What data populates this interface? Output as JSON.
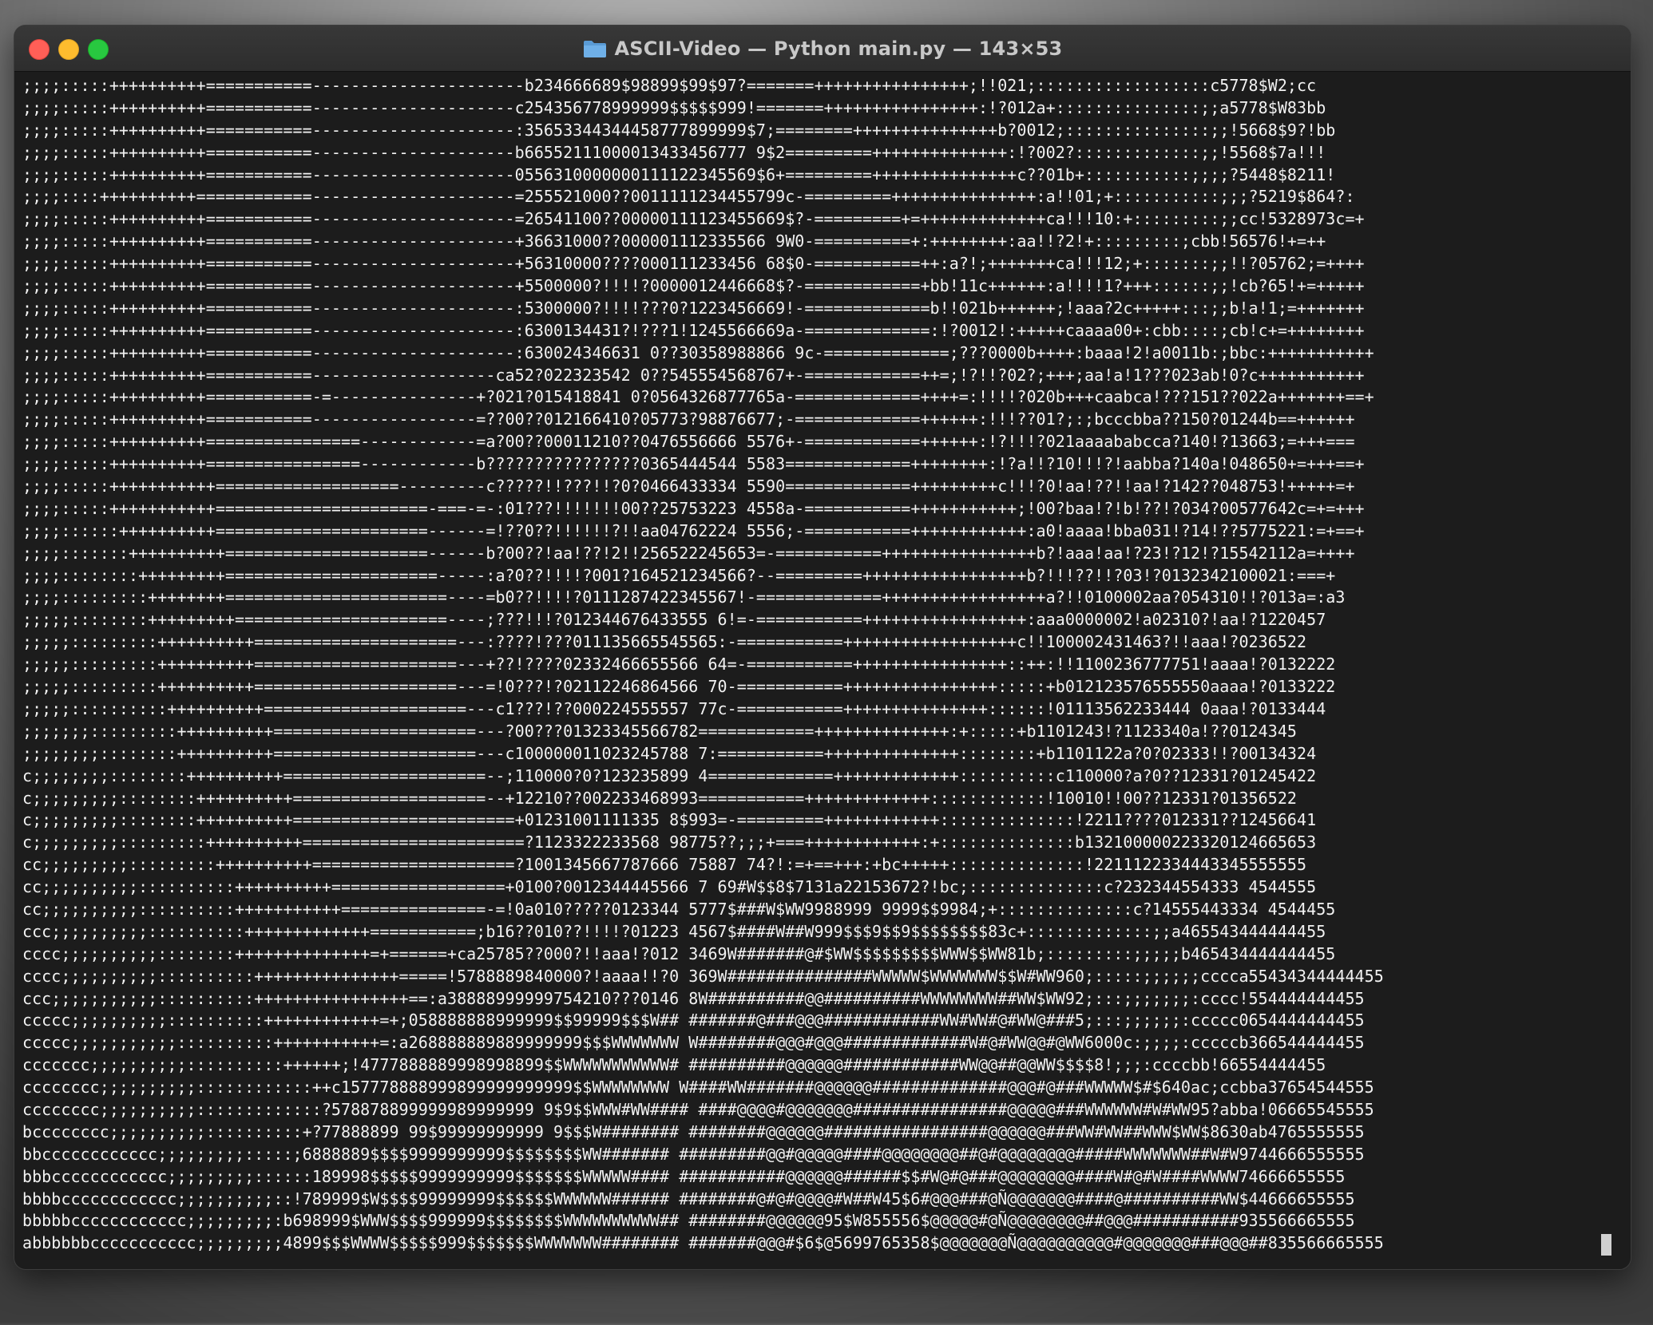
{
  "window": {
    "title": "ASCII-Video — Python main.py — 143×53",
    "folder_icon": "folder-icon",
    "traffic_lights": {
      "close": "#ff5f57",
      "minimize": "#febc2e",
      "zoom": "#28c840"
    }
  },
  "terminal": {
    "background": "#1c1c1c",
    "text_color": "#f2f2f2",
    "lines": [
      ";;;;:::::++++++++++===========----------------------b234666689$98899$99$97?=======++++++++++++++++;!!021;::::::::::::::::::c5778$W2;cc",
      ";;;;:::::++++++++++===========---------------------c254356778999999$$$$$999!=======++++++++++++++++:!?012a+:::::::::::::::;;a5778$W83bb",
      ";;;;:::::++++++++++===========---------------------:35653344344458777899999$7;========+++++++++++++++b?0012;:::::::::::::::;;!5668$9?!bb",
      ";;;;:::::++++++++++===========---------------------b66552111000013433456777 9$2=========++++++++++++++:!?002?:::::::::::::;;!5568$7a!!!",
      ";;;;:::::++++++++++===========---------------------0556310000000111122345569$6+=========+++++++++++++++c??01b+:::::::::::;;;;?5448$8211!",
      ";;;;::::++++++++++============---------------------=255521000??0011111234455799c-=========+++++++++++++++:a!!01;+:::::::::::;;;?5219$864?:",
      ";;;;:::::++++++++++===========---------------------=26541100??00000111123455669$?-=========+=+++++++++++++ca!!!10:+:::::::::;;cc!5328973c=+",
      ";;;;:::::++++++++++===========---------------------+36631000??000001112335566 9W0-==========+:++++++++:aa!!?2!+:::::::::;cbb!56576!+=++",
      ";;;;:::::++++++++++===========---------------------+56310000????000111233456 68$0-===========++:a?!;+++++++ca!!!12;+:::::::;;!!?05762;=++++",
      ";;;;:::::++++++++++===========---------------------+5500000?!!!!?0000012446668$?-============+bb!11c++++++:a!!!!1?+++::::::;;!cb?65!+=+++++",
      ";;;;:::::++++++++++===========---------------------:5300000?!!!!???0?1223456669!-=============b!!021b++++++;!aaa?2c+++++:::;;b!a!1;=+++++++",
      ";;;;:::::++++++++++===========---------------------:6300134431?!???1!1245566669a-=============:!?0012!:+++++caaaa00+:cbb::::;cb!c+=++++++++",
      ";;;;:::::++++++++++===========---------------------:630024346631 0??30358988866 9c-=============;???0000b++++:baaa!2!a0011b:;bbc:+++++++++++",
      ";;;;:::::++++++++++===========-------------------ca52?022323542 0??545554568767+-============++=;!?!!?02?;+++;aa!a!1???023ab!0?c+++++++++++",
      ";;;;:::::++++++++++===========-=---------------+?021?015418841 0?0564326877765a-=============++++=:!!!!?020b+++caabca!???151??022a+++++++==+",
      ";;;;:::::++++++++++===========-----------------=??00??012166410?05773?98876677;-=============++++++:!!!??01?;:;bcccbba??150?01244b==++++++",
      ";;;;:::::++++++++++================------------=a?00??00011210??0476556666 5576+-============++++++:!?!!!?021aaaababcca?140!?13663;=+++===",
      ";;;;:::::++++++++++================------------b????????????????0365444544 5583=============++++++++:!?a!!?10!!!?!aabba?140a!048650+=+++==+",
      ";;;;:::::+++++++++++===================---------c?????!!???!!?0?0466433334 5590=============+++++++++c!!!?0!aa!??!!aa!?142??048753!+++++=+",
      ";;;;:::::+++++++++++======================-===-=-:01???!!!!!!!00??25753223 4558a-===========+++++++++++;!00?baa!?!b!??!?034?00577642c=+=+++",
      ";;;;::::::++++++++++======================------=!??0??!!!!!!?!!aa04762224 5556;-===========++++++++++++:a0!aaaa!bba031!?14!??5775221:=+==+",
      ";;;;:::::::++++++++++=====================------b?00??!aa!??!2!!256522245653=-===========++++++++++++++++b?!aaa!aa!?23!?12!?15542112a=++++",
      ";;;;::::::::+++++++++======================-----:a?0??!!!!?001?164521234566?--=========+++++++++++++++++b?!!!??!!?03!?0132342100021:===+",
      ";;;;:::::::::++++++++=======================----=b0??!!!!?0111287422345567!-=============+++++++++++++++++a?!!0100002aa?054310!!?013a=:a3",
      ";;;;;::::::::+++++++++======================----;???!!!?012344676433555 6!=-===========+++++++++++++++++:aaa0000002!a02310?!aa!?1220457",
      ";;;;;:::::::::++++++++++=====================---:????!???011135665545565:-===========++++++++++++++++++c!!100002431463?!!aaa!?0236522",
      ";;;;;:::::::::++++++++++=====================---+??!????02332466655566 64=-===========++++++++++++++++::++:!!1100236777751!aaaa!?0132222",
      ";;;;;:::::::::++++++++++=====================---=!0???!?02112246864566 70-===========++++++++++++++++:::::+b012123576555550aaaa!?0133222",
      ";;;;;::::::::::++++++++++=====================---c1???!??000224555557 77c-===========+++++++++++++++::::::!01113562233444 0aaa!?0133444",
      ";;;;;;;:::::::::++++++++++=====================---?00???01323345566782============++++++++++++++:+:::::+b1101243!?1123340a!??0124345",
      ";;;;;;;;::::::::++++++++++=====================---c100000011023245788 7:===========++++++++++++++::::::::+b1101122a?0?02333!!?00134324",
      "c;;;;;;;;::::::::++++++++++=====================--;110000?0?123235899 4=============+++++++++++++::::::::::c110000?a?0??12331?01245422",
      "c;;;;;;;;;::::::::++++++++++====================--+12210??002233468993===========+++++++++++++::::::::::::!10010!!00??12331?01356522",
      "c;;;;;;;;;::::::::++++++++++=======================+01231001111335 8$993=-=========++++++++++++::::::::::::::!2211????012331??12456641",
      "c;;;;;;;;;:::::::::++++++++++=======================?1123322233568 98775??;;;+===++++++++++++:+::::::::::::::b132100000223320124665653",
      "cc;;;;;;;;;:::::::::++++++++++=====================?1001345667787666 75887 74?!:=+==+++:+bc+++++::::::::::::::!2211122334443345555555",
      "cc;;;;;;;;;;::::::::::++++++++++==================+0100?0012344445566 7 69#W$$8$7131a22153672?!bc;::::::::::::::c?232344554333 4544555",
      "cc;;;;;;;;;;::::::::::+++++++++++===============-=!0a010?????0123344 5777$###W$WW9988999 9999$$9984;+::::::::::::::c?14555443334 4544455",
      "ccc;;;;;;;;;;::::::::::+++++++++++++===========;b16??010??!!!!?01223 4567$####W##W999$$$9$$9$$$$$$$$83c+:::::::::::::;;a465543444444455",
      "cccc;;;;;;;;;;::::::::++++++++++++++=+======+ca25785??000?!!aaa!?012 3469W#######@#$WW$$$$$$$$$WWW$$WW81b;:::::::::;;;;;b465434444444455",
      "cccc;;;;;;;;;;::::::::::+++++++++++++++=====!5788889840000?!aaaa!!?0 369W###############WWWWW$WWWWWWW$$W#WW960;:::::;;;;;;cccca55434344444455",
      "ccc;;;;;;;;;;;::::::::::++++++++++++++++==:a38888999999754210???0146 8W##########@@##########WWWWWWWW##WW$WW92;:::;;;;;;;:cccc!554444444455",
      "ccccc;;;;;;;;;;::::::::::++++++++++++=+;058888888999999$$99999$$$W## #######@###@@@############WW#WW#@#WW@###5;:::;;;;;;:ccccc0654444444455",
      "ccccc;;;;;;;;;;;::::::::::+++++++++++=:a268888889889999999$$$WWWWWWW W########@@@#@@@#############W#@#WW@@#@WW6000c:;;;;:cccccb366544444455",
      "ccccccc;;;;;;;;;;::::::::::++++++;!4777888889998998899$$WWWWWWWWWWW# ##########@@@@@@############WW@@##@@WW$$$$8!;;;:ccccbb!66554444455",
      "cccccccc;;;;;;;;;;::::::::::::++c157778888999899999999999$$WWWWWWWW W####WW#######@@@@@@##############@@@#@###WWWWW$#$640ac;ccbba37654544555",
      "cccccccc;;;;;;;;;;:::::::::::::?578878899999989999999 9$9$$WWW#WW#### ####@@@@#@@@@@@@################@@@@@###WWWWWW#W#WW95?abba!06665545555",
      "bcccccccc;;;;;;;;;;::::::::::+?77888899 99$99999999999 9$$$W######## ########@@@@@@#################@@@@@@###WW#WW##WWW$WW$8630ab4765555555",
      "bbcccccccccccc;;;;;;;;;:::::;6888889$$$$9999999999$$$$$$$$WW####### #########@@#@@@@@####@@@@@@@@##@#@@@@@@@@#####WWWWWWW##W#W9744666555555",
      "bbbcccccccccccc;;;;;;;;;::::::189998$$$$$9999999999$$$$$$$WWWWW#### ###########@@@@@@######$$#W@#@###@@@@@@@@####W#@#W####WWWW74666655555",
      "bbbbcccccccccccc;;;;;;;;;;::!789999$W$$$$99999999$$$$$$WWWWWW###### ########@#@#@@@@#W##W45$6#@@@###@Ñ@@@@@@@####@##########WW$44666655555",
      "bbbbbcccccccccccc;;;;;;;;;:b698999$WWW$$$$999999$$$$$$$$WWWWWWWWWW## ########@@@@@@95$W855556$@@@@@#@Ñ@@@@@@@@##@@@###########935566665555",
      "abbbbbbccccccccccc;;;;;;;;;4899$$$WWWW$$$$$999$$$$$$$WWWWWWW######## #######@@@#$6$@5699765358$@@@@@@@Ñ@@@@@@@@@@#@@@@@@@###@@@##835566665555"
    ]
  }
}
